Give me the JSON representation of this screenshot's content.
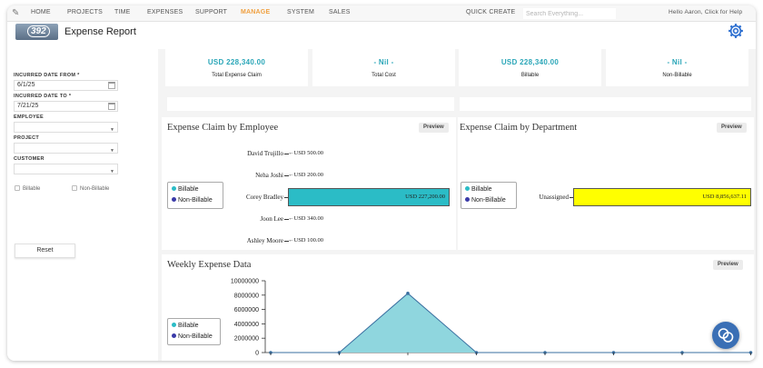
{
  "nav": {
    "items": [
      {
        "label": "HOME",
        "active": false
      },
      {
        "label": "PROJECTS",
        "active": false
      },
      {
        "label": "TIME",
        "active": false
      },
      {
        "label": "EXPENSES",
        "active": false
      },
      {
        "label": "SUPPORT",
        "active": false
      },
      {
        "label": "MANAGE",
        "active": true
      },
      {
        "label": "SYSTEM",
        "active": false
      },
      {
        "label": "SALES",
        "active": false
      }
    ],
    "quick_create": "QUICK CREATE",
    "search_placeholder": "Search Everything...",
    "user_greeting": "Hello Aaron, Click for Help"
  },
  "header": {
    "logo_text": "392",
    "title": "Expense Report"
  },
  "filters": {
    "date_from_label": "INCURRED DATE FROM *",
    "date_from_value": "6/1/25",
    "date_to_label": "INCURRED DATE TO *",
    "date_to_value": "7/21/25",
    "employee_label": "EMPLOYEE",
    "project_label": "PROJECT",
    "customer_label": "CUSTOMER",
    "billable_label": "Billable",
    "non_billable_label": "Non-Billable",
    "reset_label": "Reset"
  },
  "kpis": [
    {
      "value": "USD 228,340.00",
      "label": "Total Expense Claim"
    },
    {
      "value": "- Nil -",
      "label": "Total Cost"
    },
    {
      "value": "USD 228,340.00",
      "label": "Billable"
    },
    {
      "value": "- Nil -",
      "label": "Non-Billable"
    }
  ],
  "colors": {
    "billable": "#2bbcc6",
    "non_billable": "#3a3aa8",
    "department_bar": "#ffff00",
    "area_fill": "#8fd6de",
    "area_line": "#3a6fa0",
    "accent": "#2aa6b8"
  },
  "panels": {
    "preview_label": "Preview",
    "legend_billable": "Billable",
    "legend_non_billable": "Non-Billable",
    "employee_title": "Expense Claim by Employee",
    "department_title": "Expense Claim by Department",
    "weekly_title": "Weekly Expense Data"
  },
  "chart_data": [
    {
      "type": "bar",
      "orientation": "horizontal",
      "title": "Expense Claim by Employee",
      "categories": [
        "David Trujillo",
        "Neha Joshi",
        "Corey Bradley",
        "Joon Lee",
        "Ashley Moore"
      ],
      "values": [
        500,
        200,
        227200,
        340,
        100
      ],
      "value_labels": [
        "USD 500.00",
        "USD 200.00",
        "USD 227,200.00",
        "USD 340.00",
        "USD 100.00"
      ],
      "xlim": [
        0,
        227200
      ],
      "legend": "left",
      "series_legend": [
        "Billable",
        "Non-Billable"
      ]
    },
    {
      "type": "bar",
      "orientation": "horizontal",
      "title": "Expense Claim by Department",
      "categories": [
        "Unassigned"
      ],
      "values": [
        8856637.11
      ],
      "value_labels": [
        "USD 8,856,637.11"
      ],
      "xlim": [
        0,
        8856637.11
      ],
      "legend": "left",
      "series_legend": [
        "Billable",
        "Non-Billable"
      ]
    },
    {
      "type": "area",
      "title": "Weekly Expense Data",
      "x": [
        0,
        1,
        2,
        3,
        4,
        5,
        6,
        7
      ],
      "values": [
        0,
        0,
        8250000,
        0,
        0,
        0,
        0,
        0
      ],
      "ylim": [
        0,
        10000000
      ],
      "yticks": [
        0,
        2000000,
        4000000,
        6000000,
        8000000,
        10000000
      ],
      "ytick_labels": [
        "0",
        "2000000",
        "4000000",
        "6000000",
        "8000000",
        "10000000"
      ],
      "legend": "left",
      "series_legend": [
        "Billable",
        "Non-Billable"
      ]
    }
  ]
}
